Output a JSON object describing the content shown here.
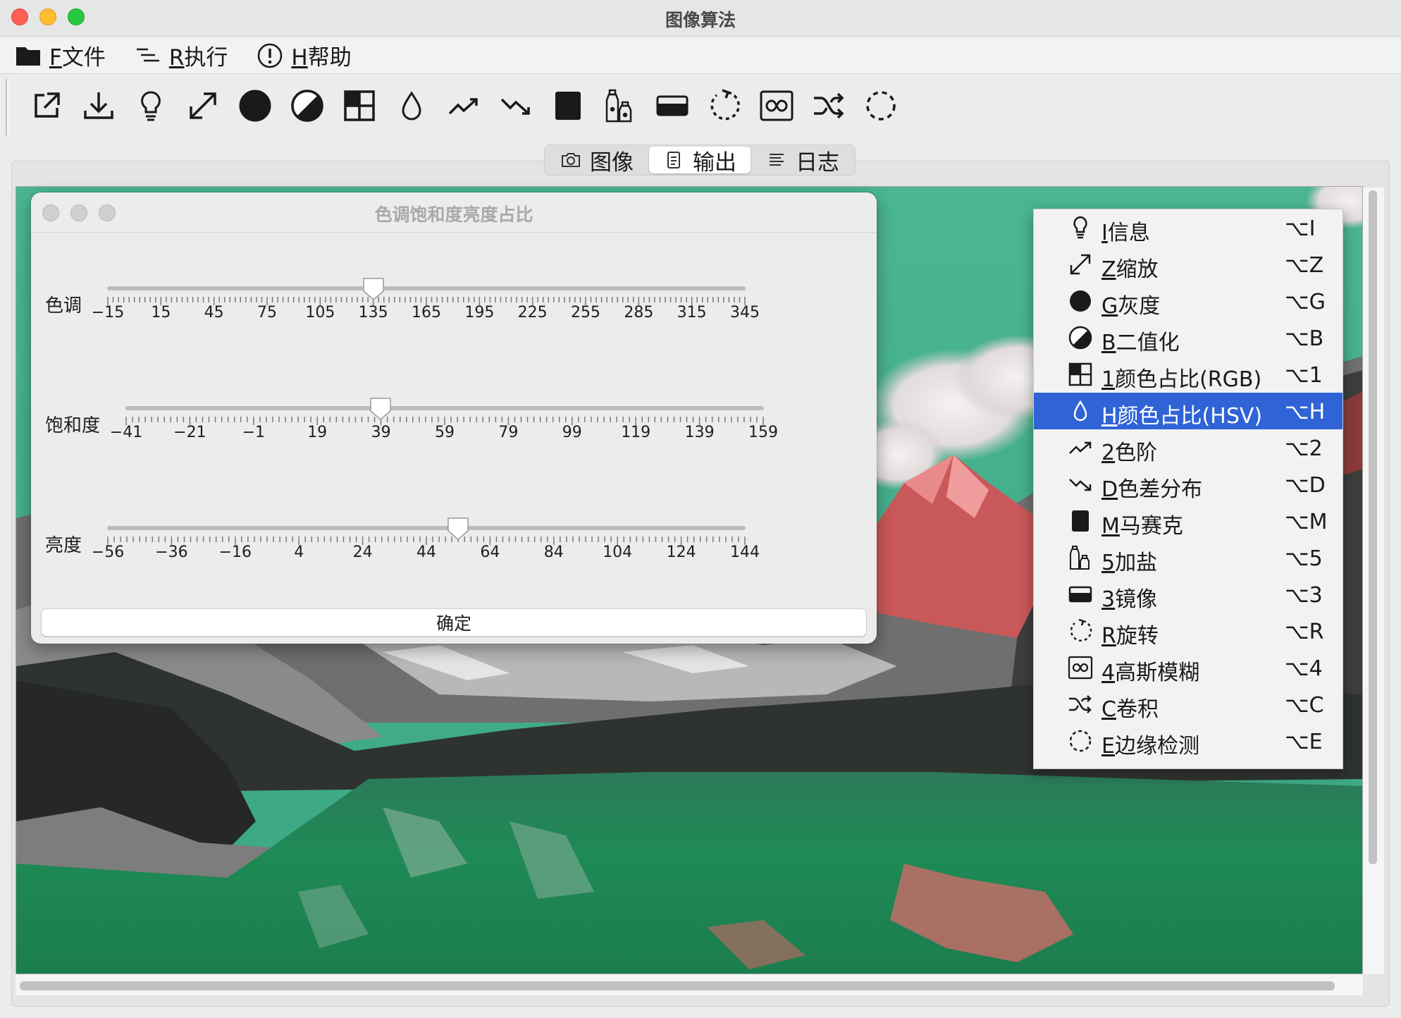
{
  "window": {
    "title": "图像算法"
  },
  "menubar": [
    {
      "mnemonic": "F",
      "label": "文件",
      "icon": "folder-icon"
    },
    {
      "mnemonic": "R",
      "label": "执行",
      "icon": "list-indent-icon"
    },
    {
      "mnemonic": "H",
      "label": "帮助",
      "icon": "info-circle-icon"
    }
  ],
  "toolbar": [
    {
      "name": "export",
      "icon": "export-icon"
    },
    {
      "name": "download",
      "icon": "download-icon"
    },
    {
      "name": "info",
      "icon": "lightbulb-icon"
    },
    {
      "name": "zoom",
      "icon": "resize-arrows-icon"
    },
    {
      "name": "grayscale",
      "icon": "filled-circle-icon"
    },
    {
      "name": "binarize",
      "icon": "half-circle-icon"
    },
    {
      "name": "color-ratio-rgb",
      "icon": "grid-icon"
    },
    {
      "name": "color-ratio-hsv",
      "icon": "droplet-icon"
    },
    {
      "name": "levels",
      "icon": "trend-up-icon"
    },
    {
      "name": "color-diff",
      "icon": "trend-down-icon"
    },
    {
      "name": "mosaic",
      "icon": "square-icon"
    },
    {
      "name": "salt",
      "icon": "bottles-icon"
    },
    {
      "name": "mirror",
      "icon": "mirror-icon"
    },
    {
      "name": "rotate",
      "icon": "rotate-icon"
    },
    {
      "name": "gaussian-blur",
      "icon": "blur-icon"
    },
    {
      "name": "convolution",
      "icon": "shuffle-icon"
    },
    {
      "name": "edge-detect",
      "icon": "dashed-circle-icon"
    }
  ],
  "tabs": [
    {
      "label": "图像",
      "icon": "camera-icon",
      "active": false
    },
    {
      "label": "输出",
      "icon": "document-icon",
      "active": true
    },
    {
      "label": "日志",
      "icon": "lines-icon",
      "active": false
    }
  ],
  "dialog": {
    "title": "色调饱和度亮度占比",
    "sliders": [
      {
        "label": "色调",
        "ticks": [
          "−15",
          "15",
          "45",
          "75",
          "105",
          "135",
          "165",
          "195",
          "225",
          "255",
          "285",
          "315",
          "345"
        ],
        "min": -15,
        "max": 345,
        "value": 135
      },
      {
        "label": "饱和度",
        "ticks": [
          "−41",
          "−21",
          "−1",
          "19",
          "39",
          "59",
          "79",
          "99",
          "119",
          "139",
          "159"
        ],
        "min": -41,
        "max": 159,
        "value": 39
      },
      {
        "label": "亮度",
        "ticks": [
          "−56",
          "−36",
          "−16",
          "4",
          "24",
          "44",
          "64",
          "84",
          "104",
          "124",
          "144"
        ],
        "min": -56,
        "max": 144,
        "value": 54
      }
    ],
    "ok_label": "确定"
  },
  "popup_menu": {
    "items": [
      {
        "mnemonic": "I",
        "label": "信息",
        "shortcut": "⌥I",
        "icon": "lightbulb-icon",
        "highlight": false
      },
      {
        "mnemonic": "Z",
        "label": "缩放",
        "shortcut": "⌥Z",
        "icon": "resize-arrows-icon",
        "highlight": false
      },
      {
        "mnemonic": "G",
        "label": "灰度",
        "shortcut": "⌥G",
        "icon": "filled-circle-icon",
        "highlight": false
      },
      {
        "mnemonic": "B",
        "label": "二值化",
        "shortcut": "⌥B",
        "icon": "half-circle-icon",
        "highlight": false
      },
      {
        "mnemonic": "1",
        "label": "颜色占比(RGB)",
        "shortcut": "⌥1",
        "icon": "grid-icon",
        "highlight": false
      },
      {
        "mnemonic": "H",
        "label": "颜色占比(HSV)",
        "shortcut": "⌥H",
        "icon": "droplet-icon",
        "highlight": true
      },
      {
        "mnemonic": "2",
        "label": "色阶",
        "shortcut": "⌥2",
        "icon": "trend-up-icon",
        "highlight": false
      },
      {
        "mnemonic": "D",
        "label": "色差分布",
        "shortcut": "⌥D",
        "icon": "trend-down-icon",
        "highlight": false
      },
      {
        "mnemonic": "M",
        "label": "马赛克",
        "shortcut": "⌥M",
        "icon": "square-icon",
        "highlight": false
      },
      {
        "mnemonic": "5",
        "label": "加盐",
        "shortcut": "⌥5",
        "icon": "bottles-icon",
        "highlight": false
      },
      {
        "mnemonic": "3",
        "label": "镜像",
        "shortcut": "⌥3",
        "icon": "mirror-icon",
        "highlight": false
      },
      {
        "mnemonic": "R",
        "label": "旋转",
        "shortcut": "⌥R",
        "icon": "rotate-icon",
        "highlight": false
      },
      {
        "mnemonic": "4",
        "label": "高斯模糊",
        "shortcut": "⌥4",
        "icon": "blur-icon",
        "highlight": false
      },
      {
        "mnemonic": "C",
        "label": "卷积",
        "shortcut": "⌥C",
        "icon": "shuffle-icon",
        "highlight": false
      },
      {
        "mnemonic": "E",
        "label": "边缘检测",
        "shortcut": "⌥E",
        "icon": "dashed-circle-icon",
        "highlight": false
      }
    ]
  },
  "colors": {
    "highlight": "#2f63d6",
    "water": "#1f8a55",
    "sky": "#3fae8a",
    "mountain_red": "#e05a5a"
  }
}
